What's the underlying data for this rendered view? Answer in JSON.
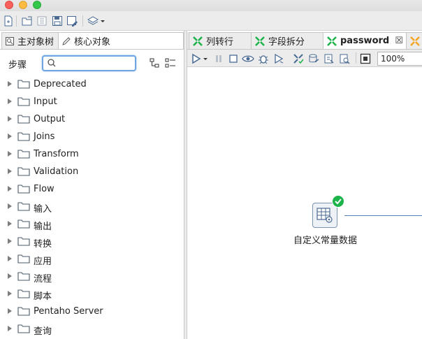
{
  "left_panel": {
    "tabs": [
      {
        "label": "主对象树",
        "icon": "tree-icon"
      },
      {
        "label": "核心对象",
        "icon": "pencil-icon"
      }
    ],
    "step_label": "步骤",
    "search": {
      "value": "",
      "placeholder": ""
    },
    "tree_items": [
      {
        "label": "Deprecated"
      },
      {
        "label": "Input"
      },
      {
        "label": "Output"
      },
      {
        "label": "Joins"
      },
      {
        "label": "Transform"
      },
      {
        "label": "Validation"
      },
      {
        "label": "Flow"
      },
      {
        "label": "输入"
      },
      {
        "label": "输出"
      },
      {
        "label": "转换"
      },
      {
        "label": "应用"
      },
      {
        "label": "流程"
      },
      {
        "label": "脚本"
      },
      {
        "label": "Pentaho Server"
      },
      {
        "label": "查询"
      }
    ]
  },
  "right_panel": {
    "tabs": [
      {
        "label": "列转行",
        "active": false
      },
      {
        "label": "字段拆分",
        "active": false
      },
      {
        "label": "password",
        "active": true
      }
    ],
    "close_glyph": "☒",
    "zoom": "100%",
    "canvas": {
      "step": {
        "label": "自定义常量数据",
        "status": "success"
      }
    }
  },
  "colors": {
    "accent_blue": "#6fa5e0",
    "transform_green": "#1bb34a",
    "hop_line": "#5a80b5",
    "tab_orange": "#f5a623"
  }
}
